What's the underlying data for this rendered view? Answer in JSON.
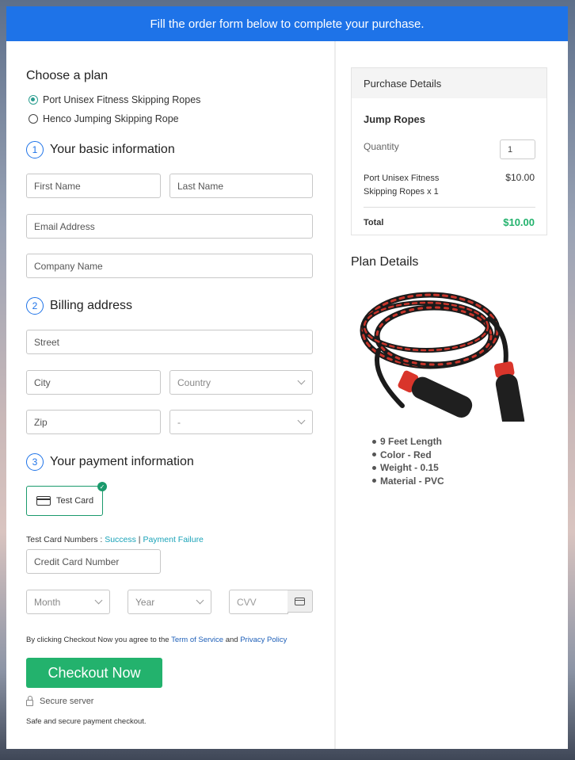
{
  "banner": {
    "text": "Fill the order form below to complete your purchase."
  },
  "plan": {
    "title": "Choose a plan",
    "options": [
      {
        "label": "Port Unisex Fitness Skipping Ropes",
        "selected": true
      },
      {
        "label": "Henco Jumping Skipping Rope",
        "selected": false
      }
    ]
  },
  "basic": {
    "num": "1",
    "title": "Your basic information",
    "first_name": "First Name",
    "last_name": "Last Name",
    "email": "Email Address",
    "company": "Company Name"
  },
  "billing": {
    "num": "2",
    "title": "Billing address",
    "street": "Street",
    "city": "City",
    "country": "Country",
    "zip": "Zip",
    "state": "-"
  },
  "payment": {
    "num": "3",
    "title": "Your payment information",
    "test_card_label": "Test Card",
    "test_numbers_label": "Test Card Numbers : ",
    "success_link": "Success",
    "sep": " | ",
    "failure_link": "Payment Failure",
    "card_number": "Credit Card Number",
    "month": "Month",
    "year": "Year",
    "cvv": "CVV"
  },
  "agree": {
    "prefix": "By clicking Checkout Now you agree to the ",
    "terms": "Term of Service",
    "and": " and ",
    "privacy": "Privacy Policy"
  },
  "checkout": {
    "label": "Checkout Now"
  },
  "secure": {
    "label": "Secure server",
    "note": "Safe and secure payment checkout."
  },
  "purchase": {
    "title": "Purchase Details",
    "product": "Jump Ropes",
    "quantity_label": "Quantity",
    "quantity": "1",
    "item": "Port Unisex Fitness Skipping Ropes x 1",
    "item_price": "$10.00",
    "total_label": "Total",
    "total": "$10.00"
  },
  "plan_details": {
    "title": "Plan Details",
    "features": [
      "9 Feet Length",
      "Color - Red",
      "Weight - 0.15",
      "Material - PVC"
    ]
  },
  "colors": {
    "accent": "#1e73e8",
    "success": "#23b26d",
    "teal": "#2a9d8f"
  }
}
